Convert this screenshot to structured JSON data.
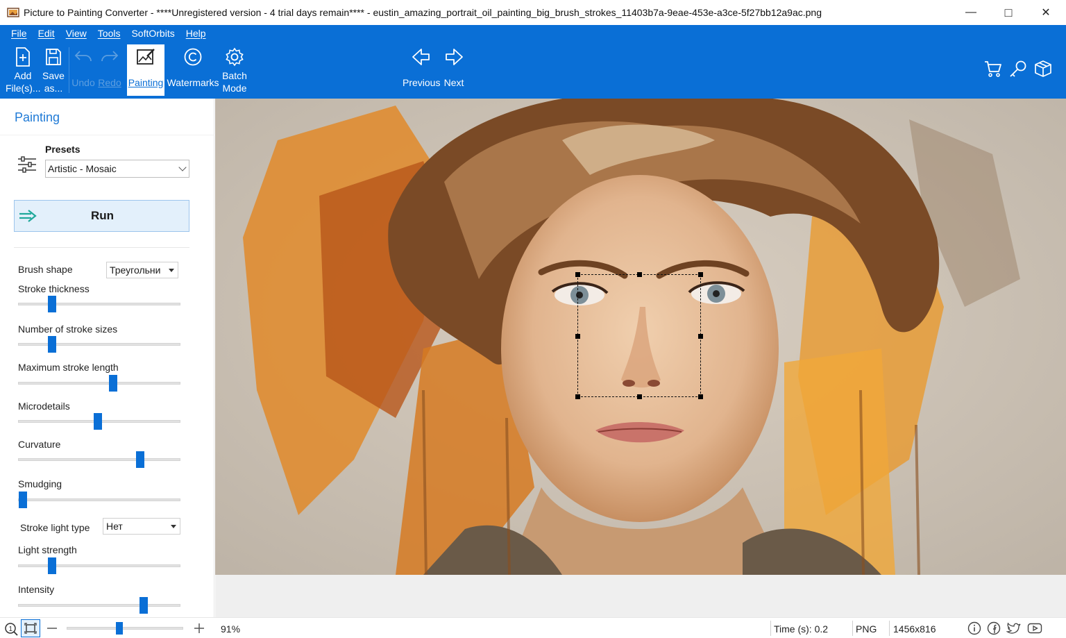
{
  "window": {
    "title": "Picture to Painting Converter - ****Unregistered version - 4 trial days remain**** - eustin_amazing_portrait_oil_painting_big_brush_strokes_11403b7a-9eae-453e-a3ce-5f27bb12a9ac.png",
    "minimize": "—",
    "maximize": "□",
    "close": "✕"
  },
  "menu": [
    "File",
    "Edit",
    "View",
    "Tools",
    "SoftOrbits",
    "Help"
  ],
  "toolbar": {
    "add_line1": "Add",
    "add_line2": "File(s)...",
    "save_line1": "Save",
    "save_line2": "as...",
    "undo": "Undo",
    "redo": "Redo",
    "painting": "Painting",
    "watermarks": "Watermarks",
    "batch_line1": "Batch",
    "batch_line2": "Mode",
    "previous": "Previous",
    "next": "Next"
  },
  "panel": {
    "title": "Painting",
    "presets_label": "Presets",
    "preset_value": "Artistic - Mosaic",
    "run_label": "Run",
    "brush_shape_label": "Brush shape",
    "brush_shape_value": "Треугольни",
    "stroke_light_type_label": "Stroke light type",
    "stroke_light_type_value": "Нет",
    "sliders": [
      {
        "label": "Stroke thickness",
        "value": 0.19
      },
      {
        "label": "Number of stroke sizes",
        "value": 0.19
      },
      {
        "label": "Maximum stroke length",
        "value": 0.59
      },
      {
        "label": "Microdetails",
        "value": 0.49
      },
      {
        "label": "Curvature",
        "value": 0.77
      },
      {
        "label": "Smudging",
        "value": 0.0
      },
      {
        "label": "Light strength",
        "value": 0.19
      },
      {
        "label": "Intensity",
        "value": 0.79
      }
    ]
  },
  "status": {
    "zoom": "91%",
    "zoom_slider": 0.45,
    "time": "Time (s): 0.2",
    "format": "PNG",
    "dimensions": "1456x816"
  },
  "colors": {
    "accent": "#0a6fd6",
    "panel_title": "#1f7ad6",
    "run_bg": "#e3f0fb"
  }
}
